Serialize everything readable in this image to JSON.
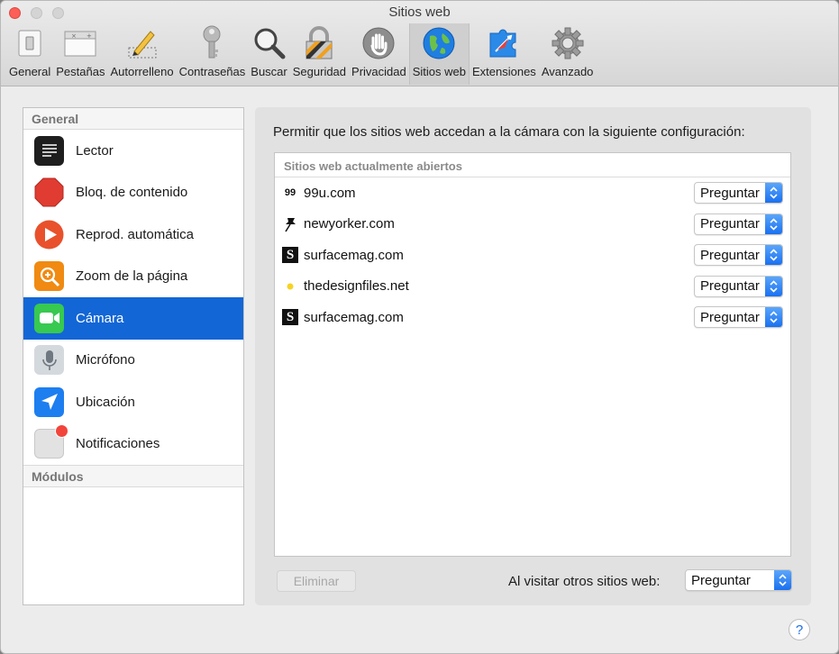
{
  "window": {
    "title": "Sitios web"
  },
  "toolbar": {
    "tabs": [
      {
        "label": "General",
        "icon": "general-icon"
      },
      {
        "label": "Pestañas",
        "icon": "tabs-icon"
      },
      {
        "label": "Autorrelleno",
        "icon": "pencil-icon"
      },
      {
        "label": "Contraseñas",
        "icon": "key-icon"
      },
      {
        "label": "Buscar",
        "icon": "magnifier-icon"
      },
      {
        "label": "Seguridad",
        "icon": "lock-icon"
      },
      {
        "label": "Privacidad",
        "icon": "hand-icon"
      },
      {
        "label": "Sitios web",
        "icon": "globe-icon",
        "active": true
      },
      {
        "label": "Extensiones",
        "icon": "puzzle-icon"
      },
      {
        "label": "Avanzado",
        "icon": "gear-icon"
      }
    ]
  },
  "sidebar": {
    "general_header": "General",
    "items": [
      {
        "label": "Lector",
        "icon": "reader-icon"
      },
      {
        "label": "Bloq. de contenido",
        "icon": "content-blocker-icon"
      },
      {
        "label": "Reprod. automática",
        "icon": "autoplay-icon"
      },
      {
        "label": "Zoom de la página",
        "icon": "zoom-icon"
      },
      {
        "label": "Cámara",
        "icon": "camera-icon",
        "selected": true
      },
      {
        "label": "Micrófono",
        "icon": "microphone-icon"
      },
      {
        "label": "Ubicación",
        "icon": "location-icon"
      },
      {
        "label": "Notificaciones",
        "icon": "notifications-icon"
      }
    ],
    "modules_header": "Módulos"
  },
  "main": {
    "description": "Permitir que los sitios web accedan a la cámara con la siguiente configuración:",
    "list_header": "Sitios web actualmente abiertos",
    "sites": [
      {
        "name": "99u.com",
        "favicon_text": "99",
        "setting": "Preguntar"
      },
      {
        "name": "newyorker.com",
        "favicon_text": "",
        "setting": "Preguntar"
      },
      {
        "name": "surfacemag.com",
        "favicon_text": "S",
        "setting": "Preguntar"
      },
      {
        "name": "thedesignfiles.net",
        "favicon_text": "",
        "setting": "Preguntar"
      },
      {
        "name": "surfacemag.com",
        "favicon_text": "S",
        "setting": "Preguntar"
      }
    ],
    "remove_button": "Eliminar",
    "other_sites_label": "Al visitar otros sitios web:",
    "other_sites_value": "Preguntar"
  },
  "help": {
    "label": "?"
  },
  "colors": {
    "accent": "#1366d6",
    "popup_arrow": "#1a70f0",
    "close": "#fc5f57"
  }
}
